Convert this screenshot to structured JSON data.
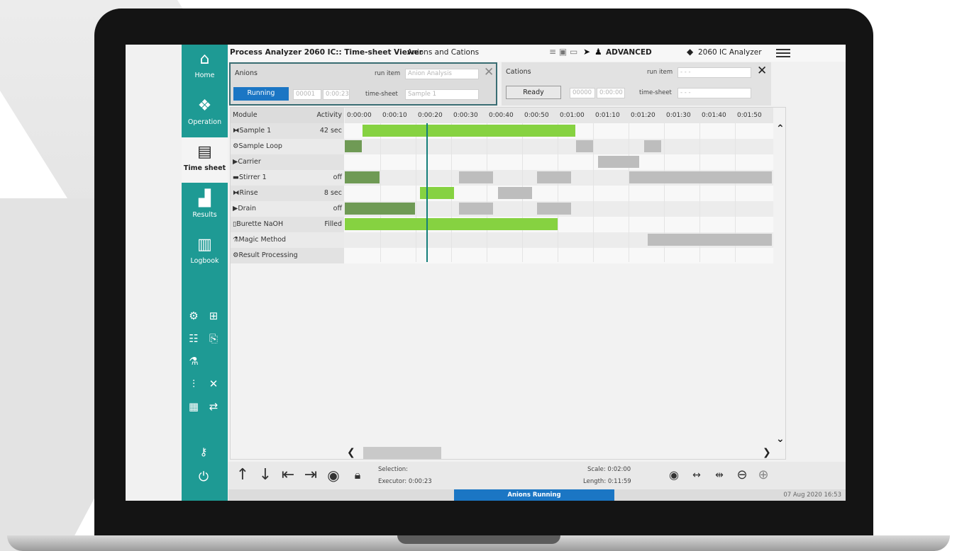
{
  "header": {
    "title": "Process Analyzer 2060 IC:: Time-sheet Viewer",
    "subtitle": "Anions and Cations",
    "user_level": "ADVANCED",
    "device": "2060 IC Analyzer"
  },
  "sidebar": {
    "items": [
      {
        "label": "Home",
        "icon": "home-icon"
      },
      {
        "label": "Operation",
        "icon": "cubes-icon"
      },
      {
        "label": "Time sheet",
        "icon": "timesheet-icon"
      },
      {
        "label": "Results",
        "icon": "chart-icon"
      },
      {
        "label": "Logbook",
        "icon": "book-icon"
      }
    ]
  },
  "anions": {
    "name": "Anions",
    "run_item_label": "run item",
    "run_item_value": "Anion Analysis",
    "status": "Running",
    "counter": "00001",
    "elapsed": "0:00:23",
    "timesheet_label": "time-sheet",
    "timesheet_value": "Sample 1"
  },
  "cations": {
    "name": "Cations",
    "run_item_label": "run item",
    "run_item_value": "- - -",
    "status": "Ready",
    "counter": "00000",
    "elapsed": "0:00:00",
    "timesheet_label": "time-sheet",
    "timesheet_value": "- - -"
  },
  "table": {
    "col_module": "Module",
    "col_activity": "Activity",
    "ticks": [
      "0:00:00",
      "0:00:10",
      "0:00:20",
      "0:00:30",
      "0:00:40",
      "0:00:50",
      "0:01:00",
      "0:01:10",
      "0:01:20",
      "0:01:30",
      "0:01:40",
      "0:01:50"
    ],
    "rows": [
      {
        "module": "Sample 1",
        "activity": "42 sec",
        "icon": "stopwatch-icon"
      },
      {
        "module": "Sample Loop",
        "activity": "",
        "icon": "loop-icon"
      },
      {
        "module": "Carrier",
        "activity": "",
        "icon": "play-icon"
      },
      {
        "module": "Stirrer 1",
        "activity": "off",
        "icon": "stirrer-icon"
      },
      {
        "module": "Rinse",
        "activity": "8 sec",
        "icon": "stopwatch-icon"
      },
      {
        "module": "Drain",
        "activity": "off",
        "icon": "play-icon"
      },
      {
        "module": "Burette NaOH",
        "activity": "Filled",
        "icon": "burette-icon"
      },
      {
        "module": "Magic Method",
        "activity": "",
        "icon": "flask-icon"
      },
      {
        "module": "Result Processing",
        "activity": "",
        "icon": "gears-icon"
      }
    ],
    "cursor_time_s": 23
  },
  "bottom": {
    "selection_label": "Selection:",
    "executor_label": "Executor: 0:00:23",
    "scale_label": "Scale: 0:02:00",
    "length_label": "Length: 0:11:59"
  },
  "status": {
    "running": "Anions Running",
    "datetime": "07 Aug 2020 16:53"
  }
}
